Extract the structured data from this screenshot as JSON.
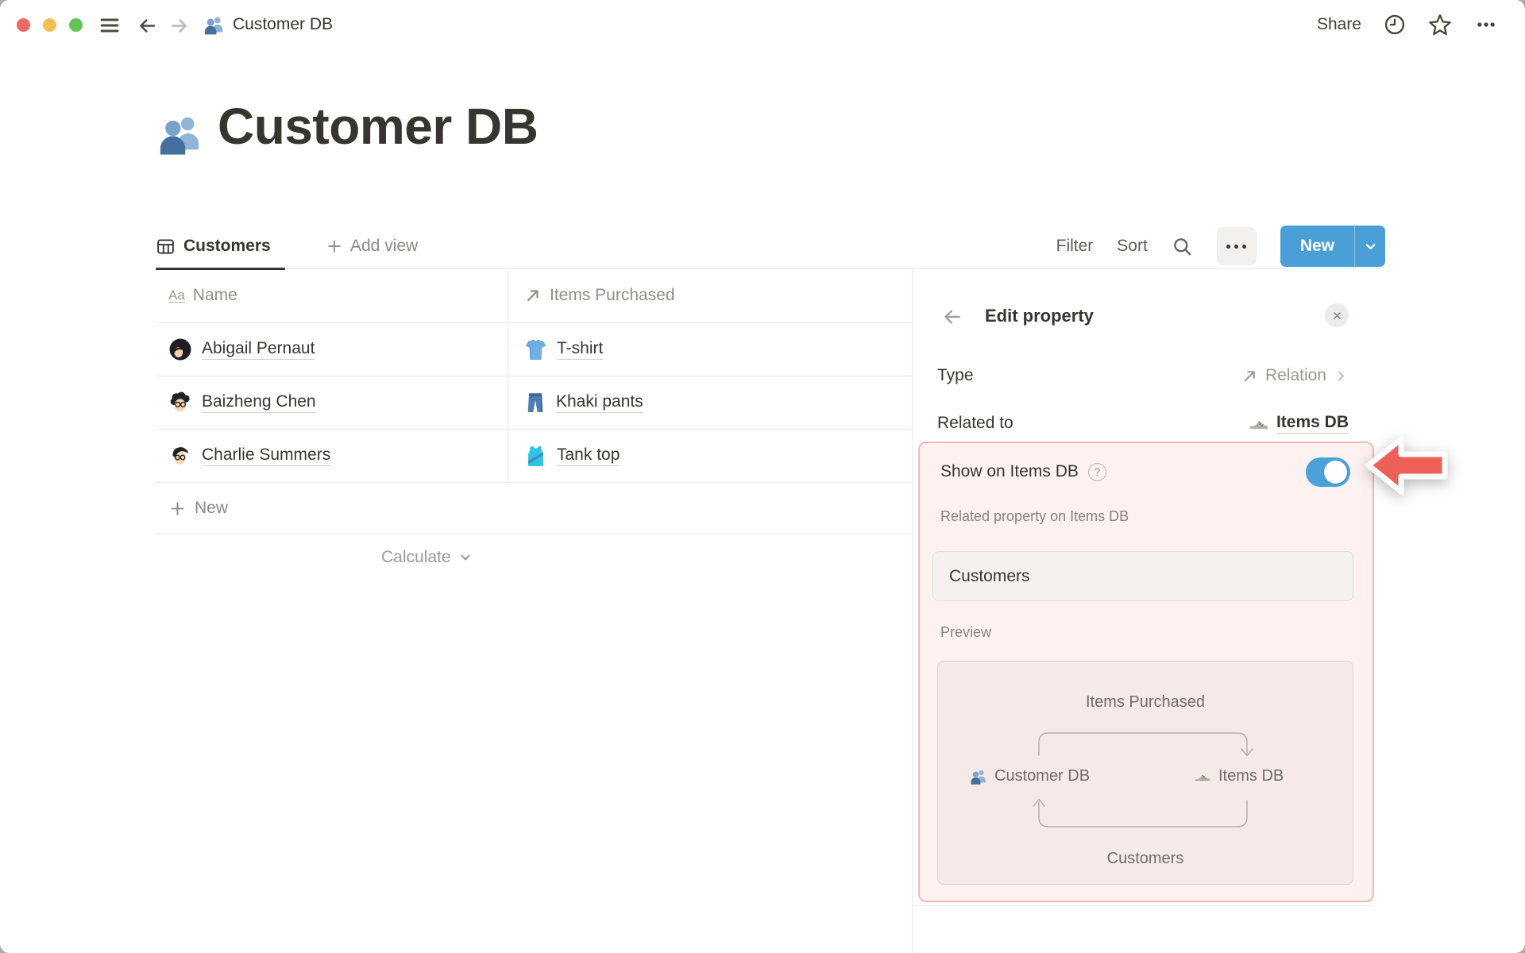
{
  "colors": {
    "accent_blue": "#4A9FD6",
    "toggle_on": "#4BA1D9",
    "highlight_bg": "#FDF2F0",
    "highlight_border": "#F3B9B4",
    "annotation_red": "#ED5F57",
    "text_dark": "#37352F",
    "text_gray": "#8F8D87"
  },
  "titlebar": {
    "title": "Customer DB",
    "share_label": "Share",
    "icons": [
      "menu-icon",
      "back-icon",
      "forward-icon",
      "people-icon",
      "clock-icon",
      "star-icon",
      "ellipsis-icon"
    ]
  },
  "page": {
    "icon": "people-emoji",
    "title": "Customer DB"
  },
  "view_bar": {
    "active_tab": "Customers",
    "add_view_label": "Add view",
    "filter_label": "Filter",
    "sort_label": "Sort",
    "search_icon": "search-icon",
    "more_icon": "ellipsis-icon",
    "new_button_label": "New"
  },
  "table": {
    "columns": [
      {
        "icon": "Aa",
        "label": "Name"
      },
      {
        "icon": "relation-arrow-icon",
        "label": "Items Purchased"
      }
    ],
    "rows": [
      {
        "avatar": "avatar-abigail",
        "name": "Abigail Pernaut",
        "item_icon": "tshirt-emoji",
        "item": "T-shirt"
      },
      {
        "avatar": "avatar-baizheng",
        "name": "Baizheng Chen",
        "item_icon": "jeans-emoji",
        "item": "Khaki pants"
      },
      {
        "avatar": "avatar-charlie",
        "name": "Charlie Summers",
        "item_icon": "tanktop-emoji",
        "item": "Tank top"
      }
    ],
    "new_row_label": "New",
    "calculate_label": "Calculate"
  },
  "edit_panel": {
    "title": "Edit property",
    "type_label": "Type",
    "type_value": "Relation",
    "related_label": "Related to",
    "related_value": "Items DB",
    "show_toggle": {
      "label": "Show on Items DB",
      "state": "on"
    },
    "related_property_label": "Related property on Items DB",
    "related_property_value": "Customers",
    "preview_label": "Preview",
    "preview": {
      "top_property": "Items Purchased",
      "left_db": "Customer DB",
      "right_db": "Items DB",
      "bottom_property": "Customers"
    }
  },
  "glyphs": {
    "name_type": "Aa",
    "help": "?"
  }
}
